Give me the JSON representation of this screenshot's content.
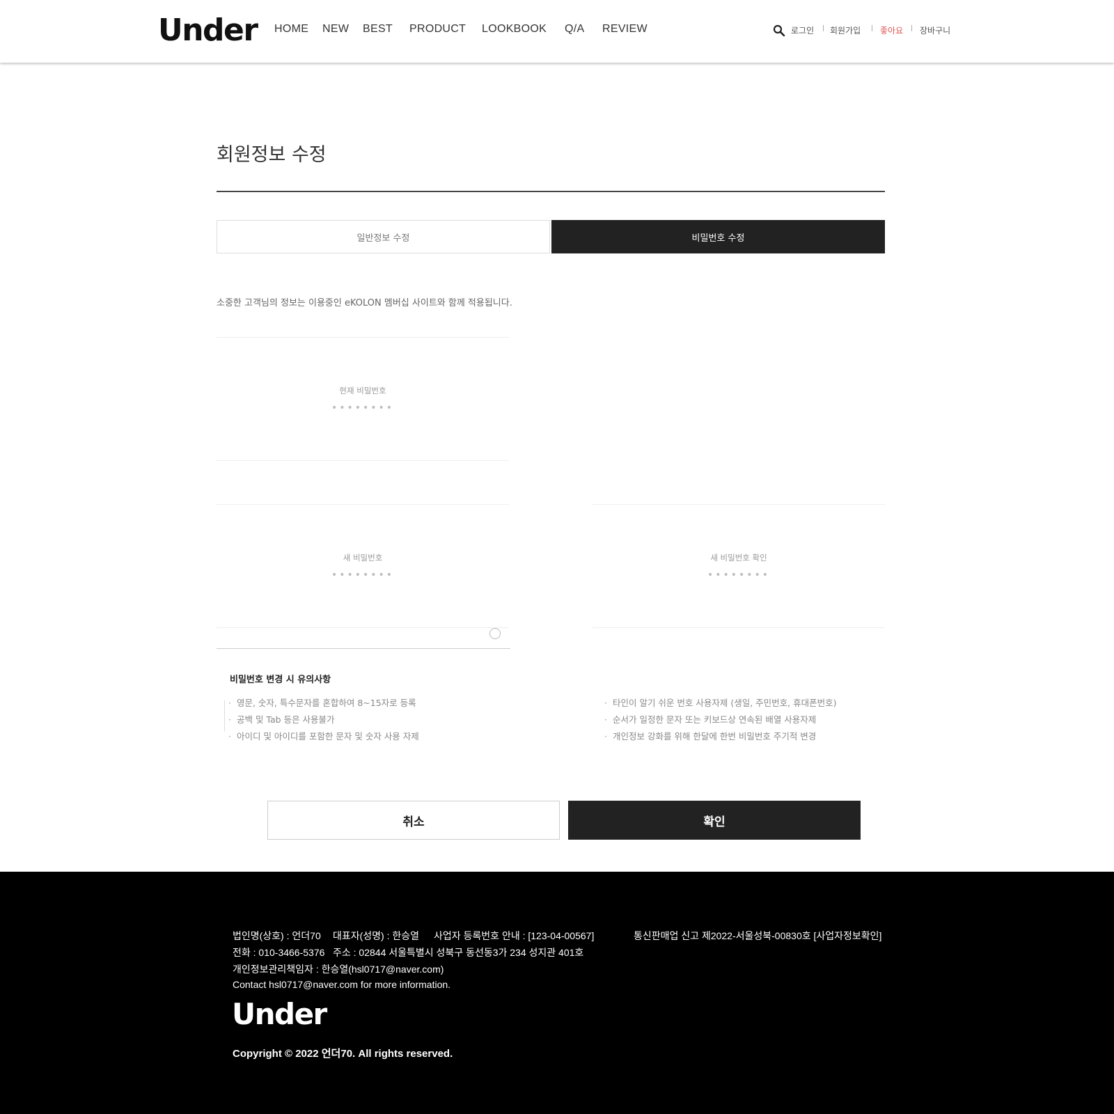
{
  "header": {
    "logo": "Under",
    "nav": [
      "HOME",
      "NEW",
      "BEST",
      "PRODUCT",
      "LOOKBOOK",
      "Q/A",
      "REVIEW"
    ],
    "util": {
      "login": "로그인",
      "signup": "회원가입",
      "like": "좋아요",
      "cart": "장바구니"
    },
    "like_color": "#e05555"
  },
  "main": {
    "title": "회원정보 수정",
    "tabs": {
      "general": "일반정보 수정",
      "password": "비밀번호 수정"
    },
    "notice": "소중한 고객님의 정보는 이용중인 eKOLON 멤버십 사이트와 함께 적용됩니다.",
    "fields": {
      "current": {
        "label": "현재 비밀번호",
        "dots": "••••••••"
      },
      "new": {
        "label": "새 비밀번호",
        "dots": "••••••••"
      },
      "confirm": {
        "label": "새 비밀번호 확인",
        "dots": "••••••••"
      }
    },
    "caution": {
      "title": "비밀번호 변경 시 유의사항",
      "left": [
        "영문, 숫자, 특수문자를 혼합하여 8~15자로 등록",
        "공백 및 Tab 등은 사용불가",
        "아이디 및 아이디를 포함한 문자 및 숫자 사용 자제"
      ],
      "right": [
        "타인이 알기 쉬운 번호 사용자제 (생일, 주민번호, 휴대폰번호)",
        "순서가 일정한 문자 또는 키보드상 연속된 배열 사용자제",
        "개인정보 강화를 위해 한달에 한번 비밀번호 주기적 변경"
      ]
    },
    "buttons": {
      "cancel": "취소",
      "confirm": "확인"
    }
  },
  "footer": {
    "line1a": "법인명(상호) : 언더70",
    "line1b": "대표자(성명) : 한승열",
    "line1c": "사업자 등록번호 안내 : [123-04-00567]",
    "line1d": "통신판매업 신고 제2022-서울성북-00830호 [사업자정보확인]",
    "line2a": "전화 : 010-3466-5376",
    "line2b": "주소 : 02844 서울특별시 성북구 동선동3가 234 성지관 401호",
    "line3": "개인정보관리책임자 : 한승열(hsl0717@naver.com)",
    "line4": "Contact hsl0717@naver.com for more information.",
    "logo": "Under",
    "copyright": "Copyright © 2022 언더70. All rights reserved."
  }
}
